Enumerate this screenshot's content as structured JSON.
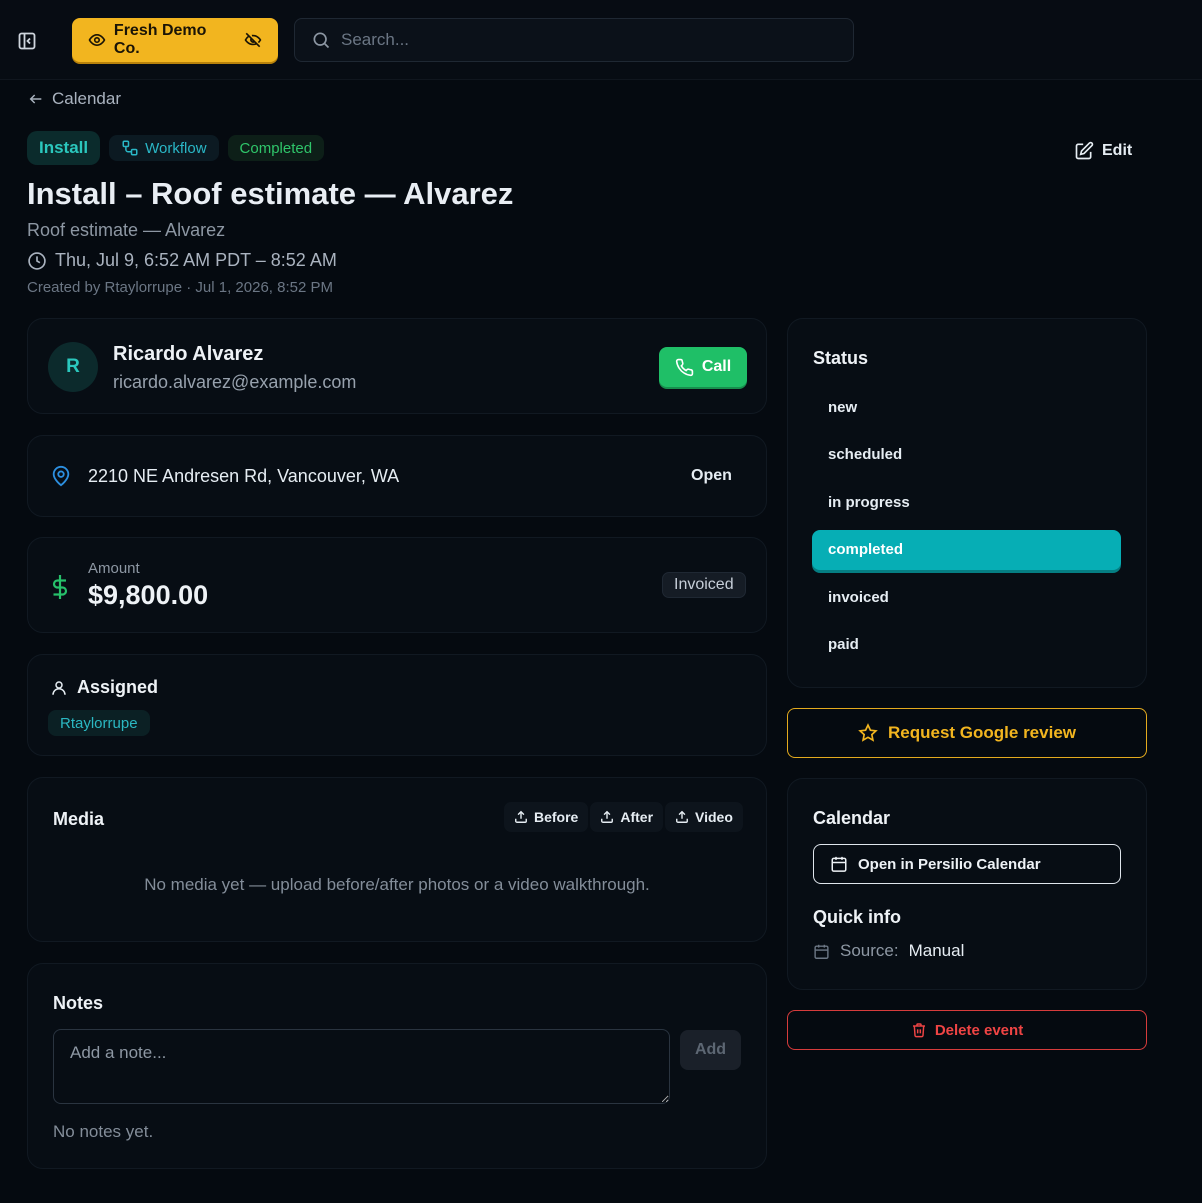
{
  "topbar": {
    "org_name": "Fresh Demo Co.",
    "search_placeholder": "Search..."
  },
  "back_label": "Calendar",
  "tags": {
    "type": "Install",
    "workflow": "Workflow",
    "state": "Completed"
  },
  "edit_label": "Edit",
  "event": {
    "title": "Install – Roof estimate — Alvarez",
    "subtitle": "Roof estimate — Alvarez",
    "when": "Thu, Jul 9, 6:52 AM PDT – 8:52 AM",
    "created": "Created by Rtaylorrupe · Jul 1, 2026, 8:52 PM"
  },
  "contact": {
    "initial": "R",
    "name": "Ricardo Alvarez",
    "email": "ricardo.alvarez@example.com",
    "call_label": "Call"
  },
  "address": {
    "text": "2210 NE Andresen Rd, Vancouver, WA",
    "open_label": "Open"
  },
  "amount": {
    "label": "Amount",
    "value": "$9,800.00",
    "badge": "Invoiced"
  },
  "assigned": {
    "title": "Assigned",
    "user": "Rtaylorrupe"
  },
  "media": {
    "title": "Media",
    "tabs": [
      "Before",
      "After",
      "Video"
    ],
    "empty": "No media yet — upload before/after photos or a video walkthrough."
  },
  "notes": {
    "title": "Notes",
    "placeholder": "Add a note...",
    "add_label": "Add",
    "empty": "No notes yet."
  },
  "status": {
    "title": "Status",
    "items": [
      "new",
      "scheduled",
      "in progress",
      "completed",
      "invoiced",
      "paid"
    ],
    "active": "completed"
  },
  "review_label": "Request Google review",
  "calendar": {
    "title": "Calendar",
    "open_label": "Open in Persilio Calendar",
    "quick_info_title": "Quick info",
    "source_label": "Source:",
    "source_value": "Manual"
  },
  "delete_label": "Delete event",
  "colors": {
    "accent_teal": "#06aeb5",
    "warning_yellow": "#f2b51f",
    "success_green": "#1fbf67",
    "danger_red": "#ef4444"
  }
}
